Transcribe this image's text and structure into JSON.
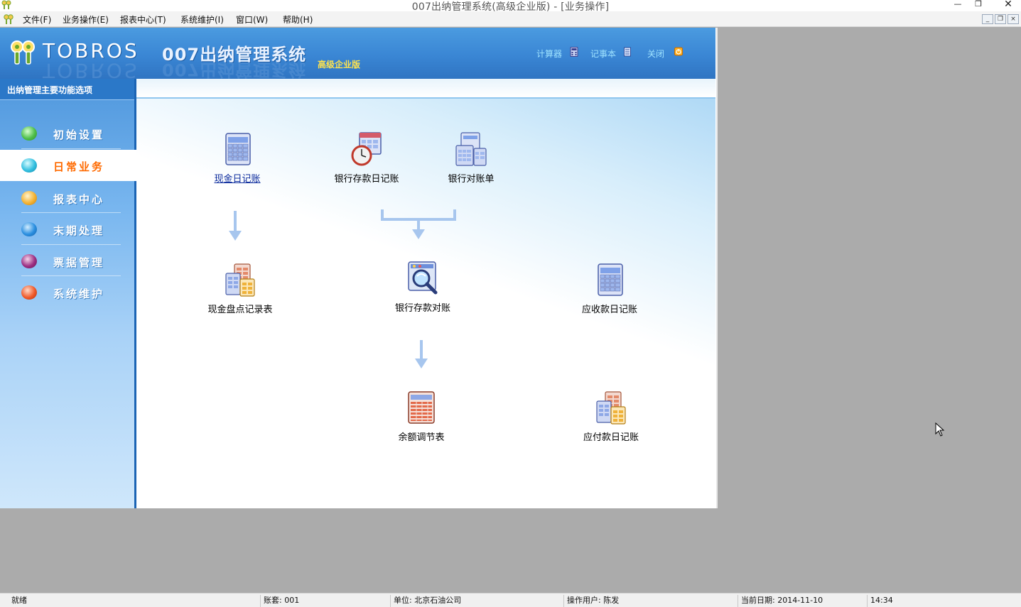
{
  "window": {
    "title": "007出纳管理系统(高级企业版) - [业务操作]",
    "minimize_glyph": "—",
    "restore_glyph": "❐",
    "close_glyph": "✕"
  },
  "menubar": {
    "items": [
      "文件(F)",
      "业务操作(E)",
      "报表中心(T)",
      "系统维护(I)",
      "窗口(W)",
      "帮助(H)"
    ],
    "mdi_buttons": [
      "_",
      "❐",
      "×"
    ]
  },
  "banner": {
    "brand": "TOBROS",
    "product": "007出纳管理系统",
    "edition": "高级企业版",
    "tools": [
      "计算器",
      "记事本",
      "关闭"
    ]
  },
  "sidebar": {
    "header": "出纳管理主要功能选项",
    "active_index": 1,
    "items": [
      {
        "label": "初始设置",
        "ball_color": "#4fbf4a"
      },
      {
        "label": "日常业务",
        "ball_color": "#33c0e0"
      },
      {
        "label": "报表中心",
        "ball_color": "#f4b232"
      },
      {
        "label": "末期处理",
        "ball_color": "#2b8fe0"
      },
      {
        "label": "票据管理",
        "ball_color": "#9c2f82"
      },
      {
        "label": "系统维护",
        "ball_color": "#f05a2a"
      }
    ]
  },
  "functions": {
    "cash_journal": "现金日记账",
    "bank_journal": "银行存款日记账",
    "bank_statement": "银行对账单",
    "cash_count": "现金盘点记录表",
    "bank_reconcile": "银行存款对账",
    "receivable_journal": "应收款日记账",
    "balance_adjust": "余额调节表",
    "payable_journal": "应付款日记账"
  },
  "statusbar": {
    "ready": "就绪",
    "account": "账套:  001",
    "unit": "单位:  北京石油公司",
    "operator": "操作用户:  陈发",
    "date": "当前日期: 2014-11-10",
    "time": "14:34"
  },
  "colors": {
    "banner_blue": "#3a86d4",
    "accent_orange": "#ff6a00",
    "edition_yellow": "#ffe34d",
    "link_blue": "#0a2a9c"
  }
}
